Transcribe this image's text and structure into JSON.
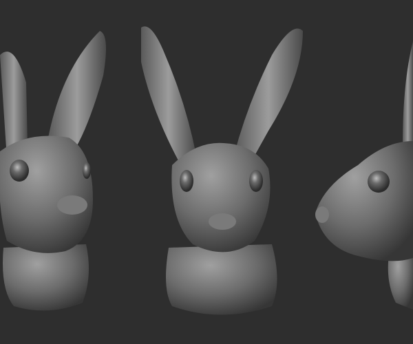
{
  "scene": {
    "subject": "hare-sculpt-busts",
    "views": [
      "three-quarter-left",
      "front",
      "side-right"
    ]
  },
  "colors": {
    "background": "#2e2e2e",
    "clay_light": "#9a9a9a",
    "clay_mid": "#6e6e6e",
    "clay_dark": "#3a3a3a",
    "eye": "#4a4a4a"
  }
}
